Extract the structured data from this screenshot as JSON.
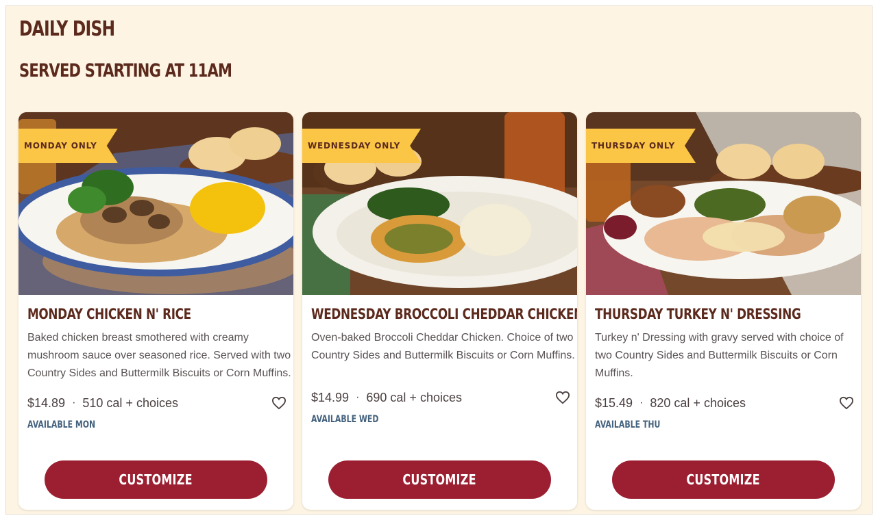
{
  "header": {
    "title": "DAILY DISH",
    "subtitle": "SERVED STARTING AT 11AM"
  },
  "colors": {
    "background": "#fdf4e3",
    "heading": "#5c2a1d",
    "tag": "#fbc545",
    "button": "#9b1f31",
    "availability": "#44627e"
  },
  "cards": [
    {
      "tag": "MONDAY ONLY",
      "name": "MONDAY CHICKEN N' RICE",
      "description": "Baked chicken breast smothered with creamy mushroom sauce over seasoned rice. Served with two Country Sides and Buttermilk Biscuits or Corn Muffins.",
      "price": "$14.89",
      "calories": "510 cal + choices",
      "availability": "AVAILABLE MON",
      "button": "CUSTOMIZE",
      "favorite_icon": "heart-icon"
    },
    {
      "tag": "WEDNESDAY ONLY",
      "name": "WEDNESDAY BROCCOLI CHEDDAR CHICKEN",
      "description": "Oven-baked Broccoli Cheddar Chicken. Choice of two Country Sides and Buttermilk Biscuits or Corn Muffins.",
      "price": "$14.99",
      "calories": "690 cal + choices",
      "availability": "AVAILABLE WED",
      "button": "CUSTOMIZE",
      "favorite_icon": "heart-icon"
    },
    {
      "tag": "THURSDAY ONLY",
      "name": "THURSDAY TURKEY N' DRESSING",
      "description": "Turkey n' Dressing with gravy served with choice of two Country Sides and Buttermilk Biscuits or Corn Muffins.",
      "price": "$15.49",
      "calories": "820 cal + choices",
      "availability": "AVAILABLE THU",
      "button": "CUSTOMIZE",
      "favorite_icon": "heart-icon"
    }
  ]
}
